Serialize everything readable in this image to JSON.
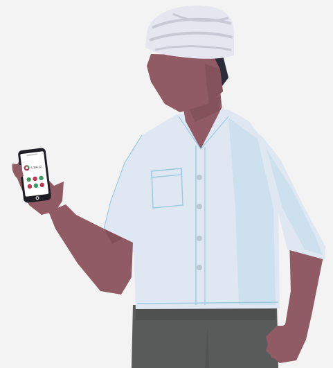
{
  "illustration": {
    "subject": "man-holding-phone",
    "colors": {
      "background": "#f3f3f3",
      "skin": "#905b64",
      "skin_shadow": "#7d4c55",
      "turban": "#e6e6f0",
      "turban_shade": "#c9c9d6",
      "hair": "#2b2b3a",
      "shirt": "#dfe8f2",
      "shirt_shade": "#bcdbea",
      "shirt_outline": "#9ccbe0",
      "button": "#b9c7d2",
      "trousers": "#595a5a",
      "trousers_shade": "#4a4a4a",
      "phone_body": "#1e1e24",
      "phone_screen": "#ffffff",
      "accent_red": "#c0344f",
      "accent_green": "#3c9a5f"
    }
  },
  "phone_screen": {
    "header_label": "",
    "balance": "6,396.22",
    "sub_label": ""
  }
}
